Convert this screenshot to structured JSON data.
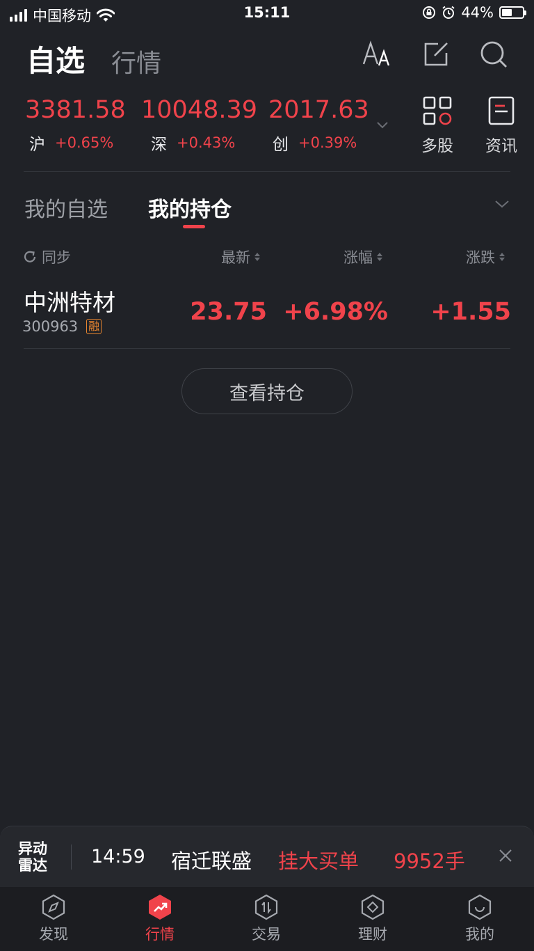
{
  "status_bar": {
    "carrier": "中国移动",
    "time": "15:11",
    "battery": "44%",
    "battery_level": 0.44
  },
  "header": {
    "tabs": [
      "自选",
      "行情"
    ],
    "active_tab": "自选",
    "icons": [
      "font-size-icon",
      "edit-icon",
      "search-icon"
    ]
  },
  "indices": [
    {
      "value": "3381.58",
      "name": "沪",
      "change": "+0.65%"
    },
    {
      "value": "10048.39",
      "name": "深",
      "change": "+0.43%"
    },
    {
      "value": "2017.63",
      "name": "创",
      "change": "+0.39%"
    }
  ],
  "quick_links": [
    {
      "label": "多股",
      "icon": "grid-icon"
    },
    {
      "label": "资讯",
      "icon": "news-icon"
    }
  ],
  "list_tabs": [
    "我的自选",
    "我的持仓"
  ],
  "active_list_tab": "我的持仓",
  "columns": {
    "sync": "同步",
    "latest": "最新",
    "pct_change": "涨幅",
    "change": "涨跌"
  },
  "holdings": [
    {
      "name": "中洲特材",
      "code": "300963",
      "badge": "融",
      "latest": "23.75",
      "pct_change": "+6.98%",
      "change": "+1.55"
    }
  ],
  "view_holdings_button": "查看持仓",
  "ticker": {
    "logo_line1": "异动",
    "logo_line2": "雷达",
    "time": "14:59",
    "stock": "宿迁联盛",
    "action": "挂大买单",
    "volume": "9952手"
  },
  "nav": [
    {
      "label": "发现",
      "icon": "compass-icon"
    },
    {
      "label": "行情",
      "icon": "trend-icon"
    },
    {
      "label": "交易",
      "icon": "trade-icon"
    },
    {
      "label": "理财",
      "icon": "wealth-icon"
    },
    {
      "label": "我的",
      "icon": "profile-icon"
    }
  ],
  "active_nav": "行情",
  "colors": {
    "up": "#f0434b",
    "background": "#202227",
    "badge": "#e6842f"
  }
}
